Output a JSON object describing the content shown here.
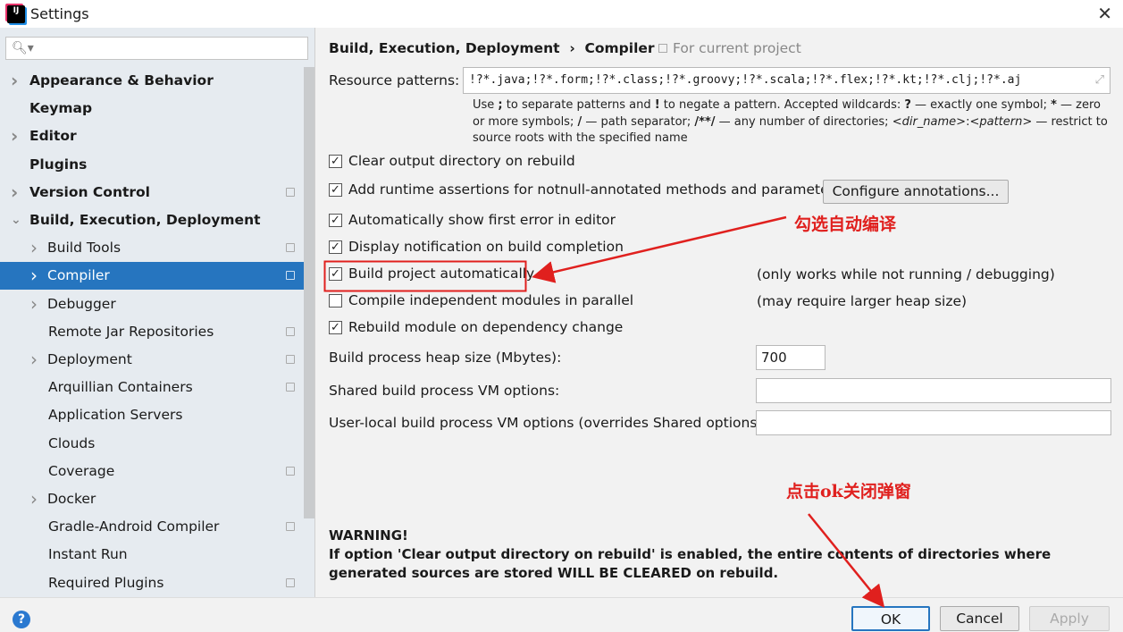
{
  "window": {
    "title": "Settings",
    "app_icon": "intellij-logo",
    "logo_text": "IJ"
  },
  "sidebar": {
    "search_placeholder": "",
    "items": [
      {
        "label": "Appearance & Behavior",
        "bold": true,
        "chevron": "right",
        "indent": 0
      },
      {
        "label": "Keymap",
        "bold": true,
        "chevron": "",
        "indent": 0
      },
      {
        "label": "Editor",
        "bold": true,
        "chevron": "right",
        "indent": 0
      },
      {
        "label": "Plugins",
        "bold": true,
        "chevron": "",
        "indent": 0
      },
      {
        "label": "Version Control",
        "bold": true,
        "chevron": "right",
        "indent": 0,
        "project": true
      },
      {
        "label": "Build, Execution, Deployment",
        "bold": true,
        "chevron": "down",
        "indent": 0
      },
      {
        "label": "Build Tools",
        "chevron": "right",
        "indent": 1,
        "project": true
      },
      {
        "label": "Compiler",
        "chevron": "right",
        "indent": 1,
        "project": true,
        "selected": true
      },
      {
        "label": "Debugger",
        "chevron": "right",
        "indent": 1
      },
      {
        "label": "Remote Jar Repositories",
        "chevron": "",
        "indent": 1,
        "project": true
      },
      {
        "label": "Deployment",
        "chevron": "right",
        "indent": 1,
        "project": true
      },
      {
        "label": "Arquillian Containers",
        "chevron": "",
        "indent": 1,
        "project": true
      },
      {
        "label": "Application Servers",
        "chevron": "",
        "indent": 1
      },
      {
        "label": "Clouds",
        "chevron": "",
        "indent": 1
      },
      {
        "label": "Coverage",
        "chevron": "",
        "indent": 1,
        "project": true
      },
      {
        "label": "Docker",
        "chevron": "right",
        "indent": 1
      },
      {
        "label": "Gradle-Android Compiler",
        "chevron": "",
        "indent": 1,
        "project": true
      },
      {
        "label": "Instant Run",
        "chevron": "",
        "indent": 1
      },
      {
        "label": "Required Plugins",
        "chevron": "",
        "indent": 1,
        "project": true
      }
    ]
  },
  "main": {
    "breadcrumb": [
      "Build, Execution, Deployment",
      "Compiler"
    ],
    "breadcrumb_sep": "›",
    "scope": "For current project",
    "resource_label": "Resource patterns:",
    "resource_value": "!?*.java;!?*.form;!?*.class;!?*.groovy;!?*.scala;!?*.flex;!?*.kt;!?*.clj;!?*.aj",
    "hint_html": "Use <b>;</b> to separate patterns and <b>!</b> to negate a pattern. Accepted wildcards: <b>?</b> — exactly one symbol; <b>*</b> — zero or more symbols; <b>/</b> — path separator; <b>/**/</b> — any number of directories; <i>&lt;dir_name&gt;</i>:<i>&lt;pattern&gt;</i> — restrict to source roots with the specified name",
    "checkboxes": [
      {
        "label": "Clear output directory on rebuild",
        "checked": true
      },
      {
        "label": "Add runtime assertions for notnull-annotated methods and parameters",
        "checked": true
      },
      {
        "label": "Automatically show first error in editor",
        "checked": true
      },
      {
        "label": "Display notification on build completion",
        "checked": true
      },
      {
        "label": "Build project automatically",
        "checked": true,
        "note": "(only works while not running / debugging)"
      },
      {
        "label": "Compile independent modules in parallel",
        "checked": false,
        "note": "(may require larger heap size)"
      },
      {
        "label": "Rebuild module on dependency change",
        "checked": true
      }
    ],
    "configure_button": "Configure annotations...",
    "heap_label": "Build process heap size (Mbytes):",
    "heap_value": "700",
    "shared_label": "Shared build process VM options:",
    "shared_value": "",
    "user_label": "User-local build process VM options (overrides Shared options):",
    "user_value": "",
    "warning_title": "WARNING!",
    "warning_text": "If option 'Clear output directory on rebuild' is enabled, the entire contents of directories where generated sources are stored WILL BE CLEARED on rebuild."
  },
  "buttons": {
    "ok": "OK",
    "cancel": "Cancel",
    "apply": "Apply",
    "help": "?"
  },
  "annotations": {
    "check_note": "勾选自动编译",
    "ok_note": "点击ok关闭弹窗",
    "color": "#e0201e"
  },
  "colors": {
    "selection": "#2675bf",
    "sidebar_bg": "#e6ebf0"
  }
}
